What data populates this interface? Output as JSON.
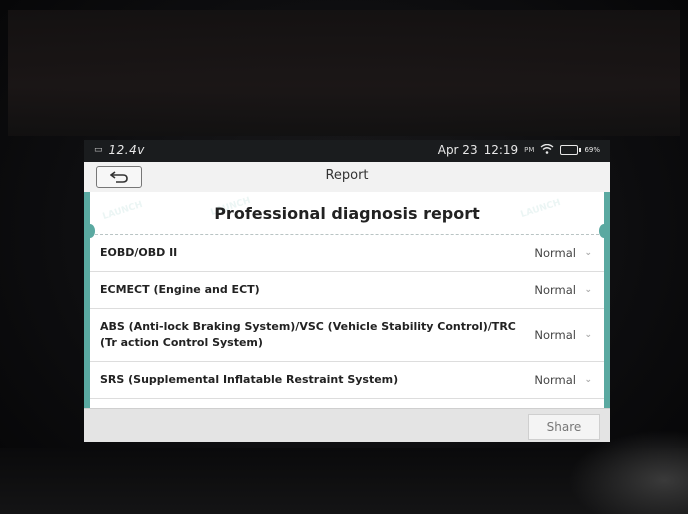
{
  "status_bar": {
    "voltage": "12.4v",
    "date": "Apr 23",
    "time": "12:19",
    "ampm": "PM",
    "battery": "69%"
  },
  "header": {
    "title": "Report",
    "back_icon": "back-arrow-icon"
  },
  "report": {
    "heading": "Professional diagnosis report",
    "rows": [
      {
        "label": "EOBD/OBD II",
        "status": "Normal"
      },
      {
        "label": "ECMECT (Engine and ECT)",
        "status": "Normal"
      },
      {
        "label": "ABS (Anti-lock Braking System)/VSC (Vehicle Stability Control)/TRC (Tr action Control System)",
        "status": "Normal"
      },
      {
        "label": "SRS (Supplemental Inflatable Restraint System)",
        "status": "Normal"
      }
    ]
  },
  "footer": {
    "share_label": "Share"
  },
  "watermark": "LAUNCH",
  "colors": {
    "accent": "#5aa9a1",
    "title_bar": "#f2f2f2"
  }
}
